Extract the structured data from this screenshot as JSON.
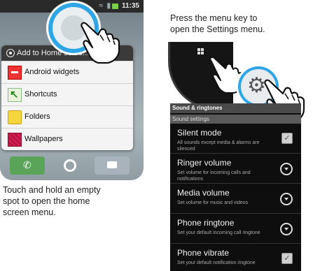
{
  "left_phone": {
    "status": {
      "time": "11:35"
    },
    "menu": {
      "title": "Add to Home scree...",
      "items": [
        {
          "label": "Android widgets",
          "icon": "android-widgets-icon"
        },
        {
          "label": "Shortcuts",
          "icon": "shortcuts-icon"
        },
        {
          "label": "Folders",
          "icon": "folder-icon"
        },
        {
          "label": "Wallpapers",
          "icon": "wallpapers-icon"
        }
      ]
    },
    "caption": [
      "Touch and hold an empty",
      "spot to open the home",
      "screen menu."
    ]
  },
  "right_phone": {
    "caption": [
      "Press the menu key to",
      "open the Settings menu."
    ],
    "screen": {
      "title": "Sound & ringtones",
      "section": "Sound settings",
      "settings": [
        {
          "title": "Silent mode",
          "summary": "All sounds except media & alarms are silenced",
          "control": "checkbox"
        },
        {
          "title": "Ringer volume",
          "summary": "Set volume for incoming calls and notifications",
          "control": "dropdown"
        },
        {
          "title": "Media volume",
          "summary": "Set volume for music and videos",
          "control": "dropdown"
        },
        {
          "title": "Phone ringtone",
          "summary": "Set your default incoming call ringtone",
          "control": "dropdown"
        },
        {
          "title": "Phone vibrate",
          "summary": "Set your default notification ringtone",
          "control": "checkbox"
        }
      ]
    }
  },
  "colors": {
    "accent_ring": "#2ea6e6"
  }
}
